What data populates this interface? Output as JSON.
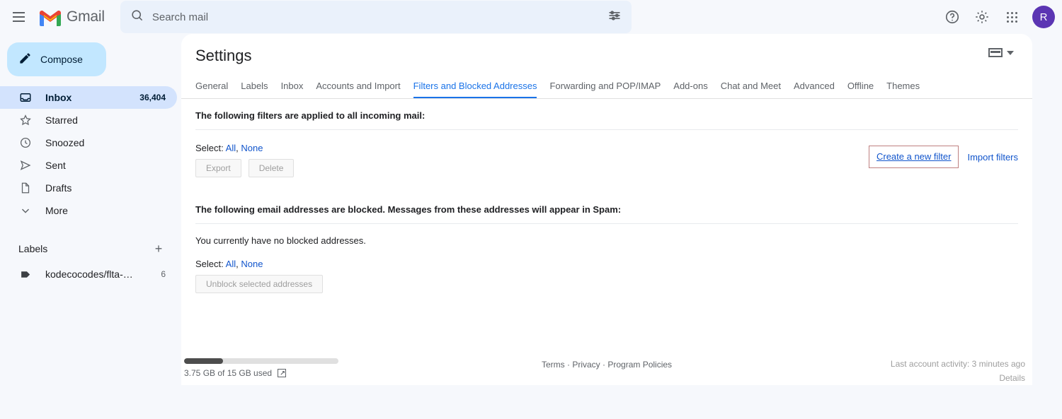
{
  "topbar": {
    "menu_icon": "hamburger-icon",
    "brand": "Gmail",
    "search_placeholder": "Search mail",
    "search_value": "",
    "search_icon": "search-icon",
    "filter_icon": "tune-icon",
    "help_icon": "help-circle-icon",
    "settings_icon": "gear-icon",
    "apps_icon": "apps-grid-icon",
    "avatar_letter": "R"
  },
  "sidebar": {
    "compose_label": "Compose",
    "compose_icon": "pencil-icon",
    "items": [
      {
        "label": "Inbox",
        "count": "36,404",
        "icon": "inbox-icon",
        "active": true
      },
      {
        "label": "Starred",
        "count": "",
        "icon": "star-icon",
        "active": false
      },
      {
        "label": "Snoozed",
        "count": "",
        "icon": "clock-icon",
        "active": false
      },
      {
        "label": "Sent",
        "count": "",
        "icon": "send-icon",
        "active": false
      },
      {
        "label": "Drafts",
        "count": "",
        "icon": "draft-icon",
        "active": false
      },
      {
        "label": "More",
        "count": "",
        "icon": "chevron-down-icon",
        "active": false
      }
    ],
    "labels_header": "Labels",
    "labels_add_icon": "plus-icon",
    "labels": [
      {
        "label": "kodecocodes/flta-…",
        "count": "6",
        "icon": "label-tag-icon"
      }
    ]
  },
  "panel": {
    "title": "Settings",
    "density_icon": "display-density-icon",
    "density_caret_icon": "chevron-down-icon",
    "tabs": [
      {
        "label": "General",
        "active": false
      },
      {
        "label": "Labels",
        "active": false
      },
      {
        "label": "Inbox",
        "active": false
      },
      {
        "label": "Accounts and Import",
        "active": false
      },
      {
        "label": "Filters and Blocked Addresses",
        "active": true
      },
      {
        "label": "Forwarding and POP/IMAP",
        "active": false
      },
      {
        "label": "Add-ons",
        "active": false
      },
      {
        "label": "Chat and Meet",
        "active": false
      },
      {
        "label": "Advanced",
        "active": false
      },
      {
        "label": "Offline",
        "active": false
      },
      {
        "label": "Themes",
        "active": false
      }
    ]
  },
  "filters_section": {
    "heading": "The following filters are applied to all incoming mail:",
    "select_label": "Select:",
    "select_all": "All",
    "select_sep": ",",
    "select_none": "None",
    "export_button": "Export",
    "delete_button": "Delete",
    "create_filter_link": "Create a new filter",
    "import_filters_link": "Import filters"
  },
  "blocked_section": {
    "heading": "The following email addresses are blocked. Messages from these addresses will appear in Spam:",
    "empty_note": "You currently have no blocked addresses.",
    "select_label": "Select:",
    "select_all": "All",
    "select_sep": ",",
    "select_none": "None",
    "unblock_button": "Unblock selected addresses"
  },
  "footer": {
    "storage_text": "3.75 GB of 15 GB used",
    "storage_percent": 25,
    "storage_link_icon": "external-link-icon",
    "terms": "Terms",
    "sep1": "·",
    "privacy": "Privacy",
    "sep2": "·",
    "policies": "Program Policies",
    "activity": "Last account activity: 3 minutes ago",
    "details": "Details"
  },
  "colors": {
    "accent": "#1a73e8",
    "link": "#1155cc",
    "compose_bg": "#c2e7ff",
    "active_nav": "#d3e3fd",
    "avatar": "#5b35b3",
    "annotation_border": "#bf8080",
    "page_bg": "#f6f8fc"
  }
}
